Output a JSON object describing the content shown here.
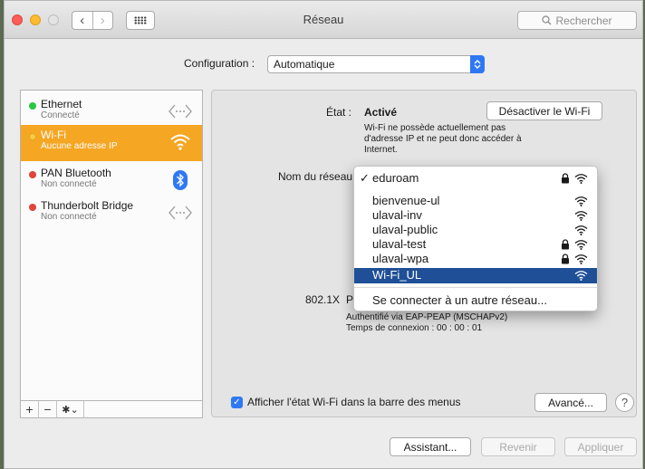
{
  "window": {
    "title": "Réseau",
    "search_placeholder": "Rechercher"
  },
  "configuration": {
    "label": "Configuration :",
    "value": "Automatique"
  },
  "services": [
    {
      "name": "Ethernet",
      "status": "Connecté",
      "dot_color": "#28c840",
      "icon": "ethernet-icon",
      "selected": false
    },
    {
      "name": "Wi-Fi",
      "status": "Aucune adresse IP",
      "dot_color": "#f7c948",
      "icon": "wifi-icon",
      "selected": true
    },
    {
      "name": "PAN Bluetooth",
      "status": "Non connecté",
      "dot_color": "#e0443a",
      "icon": "bluetooth-icon",
      "selected": false
    },
    {
      "name": "Thunderbolt Bridge",
      "status": "Non connecté",
      "dot_color": "#e0443a",
      "icon": "thunderbolt-bridge-icon",
      "selected": false
    }
  ],
  "sidebar_controls": {
    "add": "+",
    "remove": "−",
    "action": "✱⌄"
  },
  "detail": {
    "state_label": "État :",
    "state_value": "Activé",
    "toggle_button": "Désactiver le Wi-Fi",
    "message_line1": "Wi-Fi ne possède actuellement pas",
    "message_line2": "d'adresse IP et ne peut donc accéder à",
    "message_line3": "Internet.",
    "network_label": "Nom du réseau",
    "auth_label": "802.1X",
    "auth_value_fragment": "P",
    "auth_line1": "Authentifié via EAP-PEAP (MSCHAPv2)",
    "auth_line2": "Temps de connexion : 00 : 00 : 01",
    "show_wifi_status": "Afficher l'état Wi-Fi dans la barre des menus",
    "advanced_button": "Avancé...",
    "help_button": "?"
  },
  "network_menu": {
    "current": "eduroam",
    "items": [
      {
        "name": "bienvenue-ul",
        "locked": false,
        "highlighted": false
      },
      {
        "name": "ulaval-inv",
        "locked": false,
        "highlighted": false
      },
      {
        "name": "ulaval-public",
        "locked": false,
        "highlighted": false
      },
      {
        "name": "ulaval-test",
        "locked": true,
        "highlighted": false
      },
      {
        "name": "ulaval-wpa",
        "locked": true,
        "highlighted": false
      },
      {
        "name": "Wi-Fi_UL",
        "locked": false,
        "highlighted": true
      }
    ],
    "other_network": "Se connecter à un autre réseau..."
  },
  "footer": {
    "assistant": "Assistant...",
    "revert": "Revenir",
    "apply": "Appliquer"
  },
  "colors": {
    "accent": "#2f78f3",
    "selection": "#f5a623",
    "menu_highlight": "#1f4f96"
  }
}
